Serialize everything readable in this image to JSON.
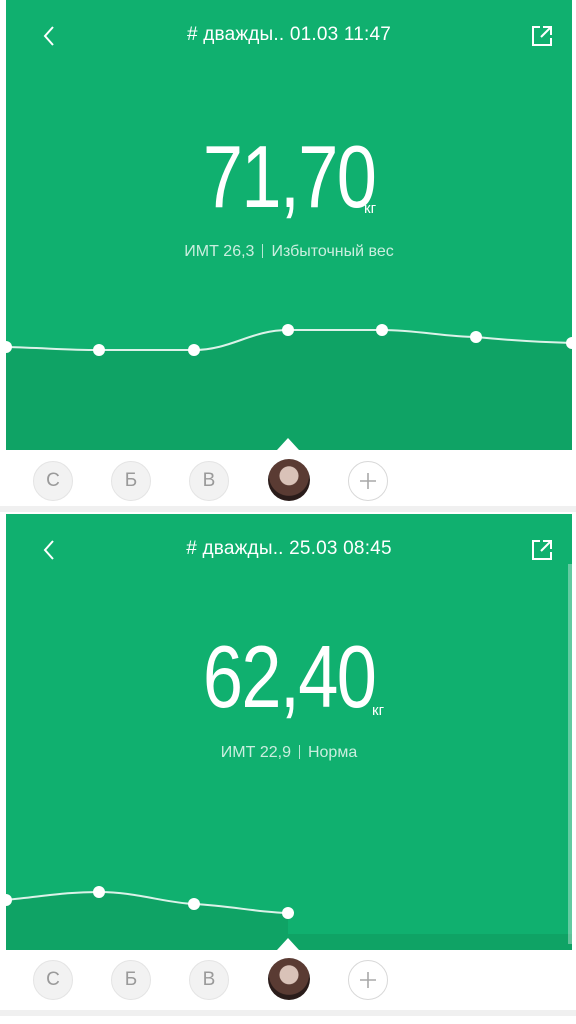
{
  "entries": [
    {
      "title": "# дважды.. 01.03 11:47",
      "weight": "71,70",
      "unit": "кг",
      "bmi_label": "ИМТ 26,3",
      "status": "Избыточный вес"
    },
    {
      "title": "# дважды.. 25.03 08:45",
      "weight": "62,40",
      "unit": "кг",
      "bmi_label": "ИМТ 22,9",
      "status": "Норма"
    }
  ],
  "profiles": {
    "letters": [
      "С",
      "Б",
      "В"
    ],
    "active": "avatar",
    "add": "+"
  },
  "colors": {
    "accent": "#10b06f",
    "accent_dark": "#0fa365"
  },
  "icons": [
    "chevron-left-icon",
    "share-icon",
    "plus-icon"
  ]
}
